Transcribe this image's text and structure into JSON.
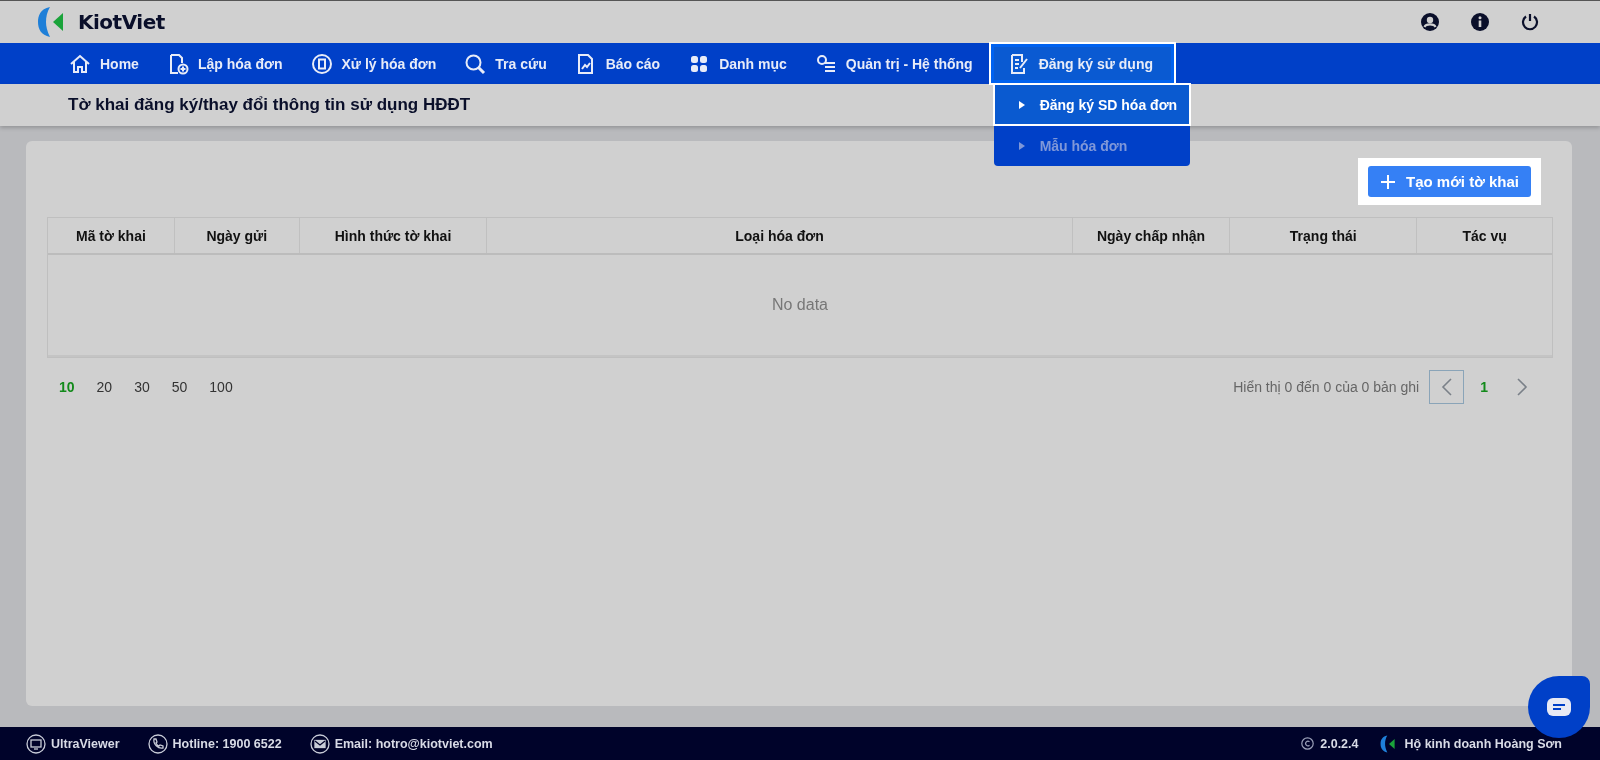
{
  "logo": {
    "text": "KiotViet"
  },
  "nav": [
    {
      "label": "Home",
      "selected": false
    },
    {
      "label": "Lập hóa đơn",
      "selected": false
    },
    {
      "label": "Xử lý hóa đơn",
      "selected": false
    },
    {
      "label": "Tra cứu",
      "selected": false
    },
    {
      "label": "Báo cáo",
      "selected": false
    },
    {
      "label": "Danh mục",
      "selected": false
    },
    {
      "label": "Quản trị - Hệ thống",
      "selected": false
    },
    {
      "label": "Đăng ký sử dụng",
      "selected": true,
      "expanded": true
    }
  ],
  "dropdown": [
    {
      "label": "Đăng ký SD hóa đơn",
      "selected": true
    },
    {
      "label": "Mẫu hóa đơn",
      "selected": false
    }
  ],
  "page_title": "Tờ khai đăng ký/thay đổi thông tin sử dụng HĐĐT",
  "create_button": {
    "label": "Tạo mới tờ khai"
  },
  "table": {
    "columns": [
      "Mã tờ khai",
      "Ngày gửi",
      "Hình thức tờ khai",
      "Loại hóa đơn",
      "Ngày chấp nhận",
      "Trạng thái",
      "Tác vụ"
    ],
    "empty_text": "No data"
  },
  "page_sizes": [
    {
      "label": "10",
      "selected": true
    },
    {
      "label": "20",
      "selected": false
    },
    {
      "label": "30",
      "selected": false
    },
    {
      "label": "50",
      "selected": false
    },
    {
      "label": "100",
      "selected": false
    }
  ],
  "pagination": {
    "summary": "Hiển thị 0 đến 0 của 0 bản ghi",
    "pages": [
      {
        "label": "1",
        "selected": true
      }
    ]
  },
  "footer": {
    "links": [
      "UltraViewer",
      "Hotline: 1900 6522",
      "Email: hotro@kiotviet.com"
    ],
    "version": "2.0.2.4",
    "business": "Hộ kinh doanh Hoàng Sơn"
  }
}
